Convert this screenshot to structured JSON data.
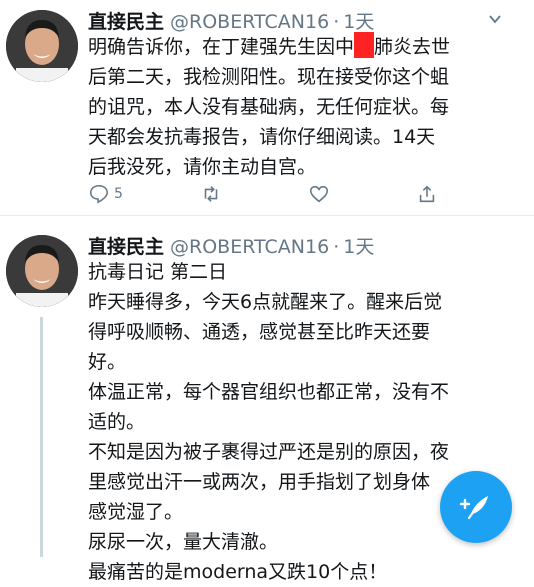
{
  "tweets": [
    {
      "author_name": "直接民主",
      "handle": "@ROBERTCAN16",
      "separator": "·",
      "time": "1天",
      "lines_before_redact": "明确告诉你，在丁建强先生因中",
      "lines_after_redact": "肺炎去世",
      "lines": [
        "后第二天，我检测阳性。现在接受你这个蛆",
        "的诅咒，本人没有基础病，无任何症状。每",
        "天都会发抗毒报告，请你仔细阅读。14天",
        "后我没死，请你主动自宫。"
      ],
      "reply_count": "5",
      "icons": [
        "reply-icon",
        "retweet-icon",
        "like-icon",
        "share-icon"
      ]
    },
    {
      "author_name": "直接民主",
      "handle": "@ROBERTCAN16",
      "separator": "·",
      "time": "1天",
      "lines": [
        "抗毒日记  第二日",
        "昨天睡得多，今天6点就醒来了。醒来后觉",
        "得呼吸顺畅、通透，感觉甚至比昨天还要",
        "好。",
        "体温正常，每个器官组织也都正常，没有不",
        "适的。",
        "不知是因为被子裹得过严还是别的原因，夜",
        "里感觉出汗一或两次，用手指划了划身体",
        "感觉湿了。",
        "尿尿一次，量大清澈。",
        "最痛苦的是moderna又跌10个点！"
      ]
    }
  ],
  "compose_icon": "compose-tweet-icon",
  "colors": {
    "accent": "#1da1f2",
    "secondary_text": "#657786",
    "redaction": "#ff2222"
  }
}
